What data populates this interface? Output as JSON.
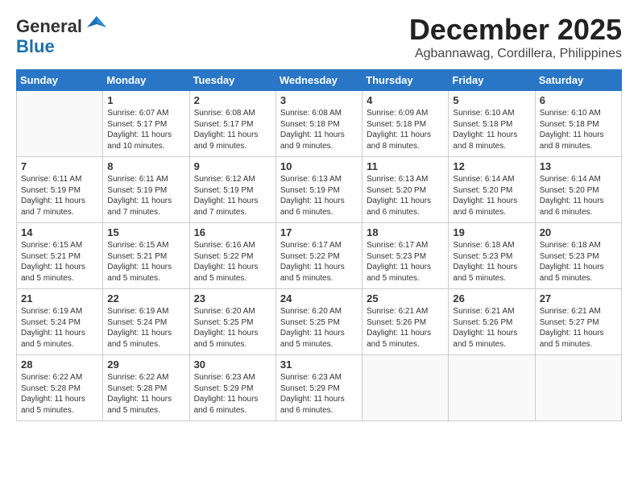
{
  "header": {
    "logo_general": "General",
    "logo_blue": "Blue",
    "month": "December 2025",
    "location": "Agbannawag, Cordillera, Philippines"
  },
  "days_of_week": [
    "Sunday",
    "Monday",
    "Tuesday",
    "Wednesday",
    "Thursday",
    "Friday",
    "Saturday"
  ],
  "weeks": [
    [
      {
        "day": "",
        "sunrise": "",
        "sunset": "",
        "daylight": "",
        "empty": true
      },
      {
        "day": "1",
        "sunrise": "Sunrise: 6:07 AM",
        "sunset": "Sunset: 5:17 PM",
        "daylight": "Daylight: 11 hours and 10 minutes."
      },
      {
        "day": "2",
        "sunrise": "Sunrise: 6:08 AM",
        "sunset": "Sunset: 5:17 PM",
        "daylight": "Daylight: 11 hours and 9 minutes."
      },
      {
        "day": "3",
        "sunrise": "Sunrise: 6:08 AM",
        "sunset": "Sunset: 5:18 PM",
        "daylight": "Daylight: 11 hours and 9 minutes."
      },
      {
        "day": "4",
        "sunrise": "Sunrise: 6:09 AM",
        "sunset": "Sunset: 5:18 PM",
        "daylight": "Daylight: 11 hours and 8 minutes."
      },
      {
        "day": "5",
        "sunrise": "Sunrise: 6:10 AM",
        "sunset": "Sunset: 5:18 PM",
        "daylight": "Daylight: 11 hours and 8 minutes."
      },
      {
        "day": "6",
        "sunrise": "Sunrise: 6:10 AM",
        "sunset": "Sunset: 5:18 PM",
        "daylight": "Daylight: 11 hours and 8 minutes."
      }
    ],
    [
      {
        "day": "7",
        "sunrise": "Sunrise: 6:11 AM",
        "sunset": "Sunset: 5:19 PM",
        "daylight": "Daylight: 11 hours and 7 minutes."
      },
      {
        "day": "8",
        "sunrise": "Sunrise: 6:11 AM",
        "sunset": "Sunset: 5:19 PM",
        "daylight": "Daylight: 11 hours and 7 minutes."
      },
      {
        "day": "9",
        "sunrise": "Sunrise: 6:12 AM",
        "sunset": "Sunset: 5:19 PM",
        "daylight": "Daylight: 11 hours and 7 minutes."
      },
      {
        "day": "10",
        "sunrise": "Sunrise: 6:13 AM",
        "sunset": "Sunset: 5:19 PM",
        "daylight": "Daylight: 11 hours and 6 minutes."
      },
      {
        "day": "11",
        "sunrise": "Sunrise: 6:13 AM",
        "sunset": "Sunset: 5:20 PM",
        "daylight": "Daylight: 11 hours and 6 minutes."
      },
      {
        "day": "12",
        "sunrise": "Sunrise: 6:14 AM",
        "sunset": "Sunset: 5:20 PM",
        "daylight": "Daylight: 11 hours and 6 minutes."
      },
      {
        "day": "13",
        "sunrise": "Sunrise: 6:14 AM",
        "sunset": "Sunset: 5:20 PM",
        "daylight": "Daylight: 11 hours and 6 minutes."
      }
    ],
    [
      {
        "day": "14",
        "sunrise": "Sunrise: 6:15 AM",
        "sunset": "Sunset: 5:21 PM",
        "daylight": "Daylight: 11 hours and 5 minutes."
      },
      {
        "day": "15",
        "sunrise": "Sunrise: 6:15 AM",
        "sunset": "Sunset: 5:21 PM",
        "daylight": "Daylight: 11 hours and 5 minutes."
      },
      {
        "day": "16",
        "sunrise": "Sunrise: 6:16 AM",
        "sunset": "Sunset: 5:22 PM",
        "daylight": "Daylight: 11 hours and 5 minutes."
      },
      {
        "day": "17",
        "sunrise": "Sunrise: 6:17 AM",
        "sunset": "Sunset: 5:22 PM",
        "daylight": "Daylight: 11 hours and 5 minutes."
      },
      {
        "day": "18",
        "sunrise": "Sunrise: 6:17 AM",
        "sunset": "Sunset: 5:23 PM",
        "daylight": "Daylight: 11 hours and 5 minutes."
      },
      {
        "day": "19",
        "sunrise": "Sunrise: 6:18 AM",
        "sunset": "Sunset: 5:23 PM",
        "daylight": "Daylight: 11 hours and 5 minutes."
      },
      {
        "day": "20",
        "sunrise": "Sunrise: 6:18 AM",
        "sunset": "Sunset: 5:23 PM",
        "daylight": "Daylight: 11 hours and 5 minutes."
      }
    ],
    [
      {
        "day": "21",
        "sunrise": "Sunrise: 6:19 AM",
        "sunset": "Sunset: 5:24 PM",
        "daylight": "Daylight: 11 hours and 5 minutes."
      },
      {
        "day": "22",
        "sunrise": "Sunrise: 6:19 AM",
        "sunset": "Sunset: 5:24 PM",
        "daylight": "Daylight: 11 hours and 5 minutes."
      },
      {
        "day": "23",
        "sunrise": "Sunrise: 6:20 AM",
        "sunset": "Sunset: 5:25 PM",
        "daylight": "Daylight: 11 hours and 5 minutes."
      },
      {
        "day": "24",
        "sunrise": "Sunrise: 6:20 AM",
        "sunset": "Sunset: 5:25 PM",
        "daylight": "Daylight: 11 hours and 5 minutes."
      },
      {
        "day": "25",
        "sunrise": "Sunrise: 6:21 AM",
        "sunset": "Sunset: 5:26 PM",
        "daylight": "Daylight: 11 hours and 5 minutes."
      },
      {
        "day": "26",
        "sunrise": "Sunrise: 6:21 AM",
        "sunset": "Sunset: 5:26 PM",
        "daylight": "Daylight: 11 hours and 5 minutes."
      },
      {
        "day": "27",
        "sunrise": "Sunrise: 6:21 AM",
        "sunset": "Sunset: 5:27 PM",
        "daylight": "Daylight: 11 hours and 5 minutes."
      }
    ],
    [
      {
        "day": "28",
        "sunrise": "Sunrise: 6:22 AM",
        "sunset": "Sunset: 5:28 PM",
        "daylight": "Daylight: 11 hours and 5 minutes."
      },
      {
        "day": "29",
        "sunrise": "Sunrise: 6:22 AM",
        "sunset": "Sunset: 5:28 PM",
        "daylight": "Daylight: 11 hours and 5 minutes."
      },
      {
        "day": "30",
        "sunrise": "Sunrise: 6:23 AM",
        "sunset": "Sunset: 5:29 PM",
        "daylight": "Daylight: 11 hours and 6 minutes."
      },
      {
        "day": "31",
        "sunrise": "Sunrise: 6:23 AM",
        "sunset": "Sunset: 5:29 PM",
        "daylight": "Daylight: 11 hours and 6 minutes."
      },
      {
        "day": "",
        "sunrise": "",
        "sunset": "",
        "daylight": "",
        "empty": true
      },
      {
        "day": "",
        "sunrise": "",
        "sunset": "",
        "daylight": "",
        "empty": true
      },
      {
        "day": "",
        "sunrise": "",
        "sunset": "",
        "daylight": "",
        "empty": true
      }
    ]
  ]
}
